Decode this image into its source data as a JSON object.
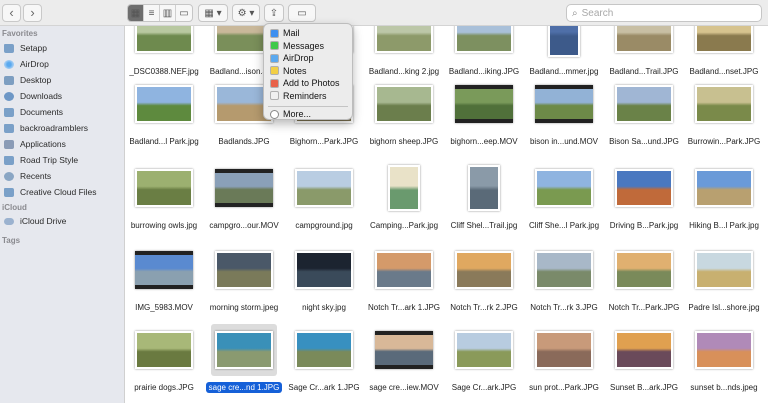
{
  "toolbar": {
    "back": "‹",
    "forward": "›",
    "view_icon": "▦",
    "list_icon": "≡",
    "column_icon": "▥",
    "gallery_icon": "▭",
    "group_icon": "▦ ▾",
    "action_icon": "⚙ ▾",
    "share_icon": "⇪",
    "tag_icon": "▭",
    "search_placeholder": "Search"
  },
  "sidebar": {
    "favorites_title": "Favorites",
    "favorites": [
      {
        "label": "Setapp",
        "icon": "folder-icon"
      },
      {
        "label": "AirDrop",
        "icon": "airdrop-icon"
      },
      {
        "label": "Desktop",
        "icon": "desktop-icon"
      },
      {
        "label": "Downloads",
        "icon": "downloads-icon"
      },
      {
        "label": "Documents",
        "icon": "documents-icon"
      },
      {
        "label": "backroadramblers",
        "icon": "folder-icon"
      },
      {
        "label": "Applications",
        "icon": "applications-icon"
      },
      {
        "label": "Road Trip Style",
        "icon": "folder-icon"
      },
      {
        "label": "Recents",
        "icon": "recents-icon"
      },
      {
        "label": "Creative Cloud Files",
        "icon": "folder-icon"
      }
    ],
    "icloud_title": "iCloud",
    "icloud": [
      {
        "label": "iCloud Drive",
        "icon": "icloud-icon"
      }
    ],
    "tags_title": "Tags"
  },
  "share_menu": {
    "items": [
      {
        "label": "Mail",
        "icon": "mail-icon",
        "color": "#3d8ff0"
      },
      {
        "label": "Messages",
        "icon": "messages-icon",
        "color": "#3ec94a"
      },
      {
        "label": "AirDrop",
        "icon": "airdrop-icon",
        "color": "#5aa9ef"
      },
      {
        "label": "Notes",
        "icon": "notes-icon",
        "color": "#f2cf45"
      },
      {
        "label": "Add to Photos",
        "icon": "photos-icon",
        "color": "#e8624a"
      },
      {
        "label": "Reminders",
        "icon": "reminders-icon",
        "color": "#f0f0f0"
      }
    ],
    "more": {
      "label": "More...",
      "icon": "more-icon"
    }
  },
  "files": [
    {
      "name": "_DSC0388.NEF.jpg",
      "colors": [
        "#b8c8a0",
        "#6e8a4e"
      ]
    },
    {
      "name": "Badland...ison.JPG",
      "colors": [
        "#c9b89a",
        "#7a8f5a"
      ]
    },
    {
      "name": "",
      "colors": [
        "#c0c8d8",
        "#8a9a70"
      ]
    },
    {
      "name": "Badland...king 2.jpg",
      "colors": [
        "#bcc7a8",
        "#8d9a6a"
      ]
    },
    {
      "name": "Badland...iking.JPG",
      "colors": [
        "#a9c0d9",
        "#7d9060"
      ]
    },
    {
      "name": "Badland...mmer.jpg",
      "colors": [
        "#4f6fa8",
        "#3d5a8a"
      ]
    },
    {
      "name": "Badland...Trail.JPG",
      "colors": [
        "#c8bfa4",
        "#9a8b66"
      ]
    },
    {
      "name": "Badland...nset.JPG",
      "colors": [
        "#d6c38e",
        "#8a7a4e"
      ]
    },
    {
      "name": "Badland...l Park.jpg",
      "colors": [
        "#8fb4e0",
        "#5e8a3e"
      ]
    },
    {
      "name": "Badlands.JPG",
      "colors": [
        "#9ab7d9",
        "#b59a6e"
      ]
    },
    {
      "name": "Bighorn...Park.JPG",
      "colors": [
        "#b7a88a",
        "#7a7050"
      ]
    },
    {
      "name": "bighorn sheep.JPG",
      "colors": [
        "#a7b890",
        "#6b7e4c"
      ]
    },
    {
      "name": "bighorn...eep.MOV",
      "colors": [
        "#7a9a5a",
        "#50703a"
      ]
    },
    {
      "name": "bison in...und.MOV",
      "colors": [
        "#92b2d6",
        "#6d8a48"
      ]
    },
    {
      "name": "Bison Sa...und.JPG",
      "colors": [
        "#a0b6d4",
        "#6a8248"
      ]
    },
    {
      "name": "Burrowin...Park.JPG",
      "colors": [
        "#c8c090",
        "#7a8a4a"
      ]
    },
    {
      "name": "burrowing owls.jpg",
      "colors": [
        "#9cb070",
        "#6a7e44"
      ]
    },
    {
      "name": "campgro...our.MOV",
      "colors": [
        "#8aa0b8",
        "#6a7a58"
      ]
    },
    {
      "name": "campground.jpg",
      "colors": [
        "#b9cde2",
        "#8a9a6a"
      ]
    },
    {
      "name": "Camping...Park.jpg",
      "colors": [
        "#e9e2c8",
        "#6a9a6e"
      ]
    },
    {
      "name": "Cliff Shel...Trail.jpg",
      "colors": [
        "#8a9aa8",
        "#5a6a78"
      ]
    },
    {
      "name": "Cliff She...l Park.jpg",
      "colors": [
        "#8fb4e0",
        "#7a9a50"
      ]
    },
    {
      "name": "Driving B...Park.jpg",
      "colors": [
        "#4a78c0",
        "#c06a3a"
      ]
    },
    {
      "name": "Hiking B...l Park.jpg",
      "colors": [
        "#6a9ad8",
        "#b8a070"
      ]
    },
    {
      "name": "IMG_5983.MOV",
      "colors": [
        "#5a8ad0",
        "#8aa0b0"
      ]
    },
    {
      "name": "morning storm.jpeg",
      "colors": [
        "#4a5868",
        "#7a7a5a"
      ]
    },
    {
      "name": "night sky.jpg",
      "colors": [
        "#1c2430",
        "#3a4a5a"
      ]
    },
    {
      "name": "Notch Tr...ark 1.JPG",
      "colors": [
        "#d49a6a",
        "#6a7a8a"
      ]
    },
    {
      "name": "Notch Tr...rk 2.JPG",
      "colors": [
        "#e0a860",
        "#8a7a5a"
      ]
    },
    {
      "name": "Notch Tr...rk 3.JPG",
      "colors": [
        "#a8b8c8",
        "#7a8a6a"
      ]
    },
    {
      "name": "Notch Tr...Park.JPG",
      "colors": [
        "#e0b070",
        "#7a8a5a"
      ]
    },
    {
      "name": "Padre Isl...shore.jpg",
      "colors": [
        "#c8d8e0",
        "#c8b070"
      ]
    },
    {
      "name": "prairie dogs.JPG",
      "colors": [
        "#a8b878",
        "#6a7a40"
      ]
    },
    {
      "name": "sage cre...nd 1.JPG",
      "colors": [
        "#3a90b8",
        "#8a9a70"
      ]
    },
    {
      "name": "Sage Cr...ark 1.JPG",
      "colors": [
        "#3890c0",
        "#7a8a5a"
      ]
    },
    {
      "name": "sage cre...iew.MOV",
      "colors": [
        "#d8b898",
        "#5a6a7a"
      ]
    },
    {
      "name": "Sage Cr...ark.JPG",
      "colors": [
        "#b8cce0",
        "#8a9a5a"
      ]
    },
    {
      "name": "sun prot...Park.JPG",
      "colors": [
        "#c89a7a",
        "#8a6a5a"
      ]
    },
    {
      "name": "Sunset B...ark.JPG",
      "colors": [
        "#e0a050",
        "#6a4a5a"
      ]
    },
    {
      "name": "sunset b...nds.jpeg",
      "colors": [
        "#b08ab8",
        "#d8905a"
      ]
    }
  ]
}
